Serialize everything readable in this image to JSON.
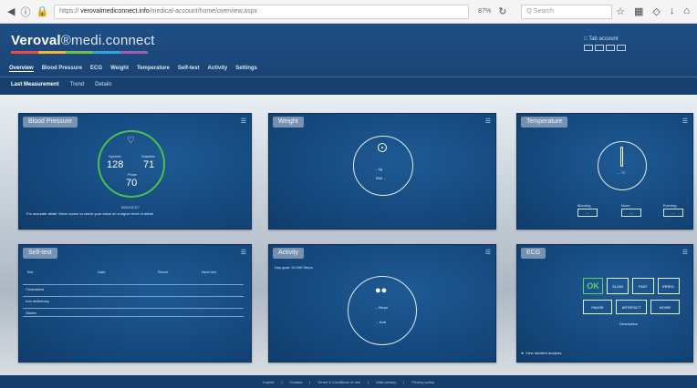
{
  "browser": {
    "url_prefix": "https://",
    "url_host": "verovalmediconnect.info",
    "url_path": "/medical-account/home/overview.aspx",
    "zoom": "87%",
    "search_placeholder": "Q Search"
  },
  "app": {
    "logo_bold": "Veroval",
    "logo_light": "®medi.connect",
    "user": "Tab account",
    "nav": [
      "Overview",
      "Blood Pressure",
      "ECG",
      "Weight",
      "Temperature",
      "Self-test",
      "Activity",
      "Settings"
    ],
    "active_nav": "Overview",
    "sub_nav": [
      "Last Measurement",
      "Trend",
      "Details"
    ],
    "active_sub_nav": "Last Measurement"
  },
  "cards": {
    "blood_pressure": {
      "title": "Blood Pressure",
      "systolic_label": "Systolic",
      "systolic": "128",
      "diastolic_label": "Diastolic",
      "diastolic": "71",
      "pulse_label": "Pulse",
      "pulse": "70",
      "date": "06/01/2017",
      "note": "For accurate detail: Move cursor to check your value on a higher level of detail."
    },
    "weight": {
      "title": "Weight",
      "value": "-- kg",
      "sub": "BMI --"
    },
    "temperature": {
      "title": "Temperature",
      "value": "-- °C",
      "boxes": [
        {
          "label": "Morning",
          "value": "--"
        },
        {
          "label": "Noon",
          "value": "--"
        },
        {
          "label": "Evening",
          "value": "--"
        }
      ]
    },
    "self_test": {
      "title": "Self-test",
      "headers": [
        "Test",
        "Date",
        "Result",
        "Next test"
      ],
      "rows": [
        "Cholesterol",
        "Iron deficiency",
        "Gluten"
      ]
    },
    "activity": {
      "title": "Activity",
      "header_text": "Day goal: 10,000 Steps",
      "steps": "-- Steps",
      "kcal": "-- kcal"
    },
    "ecg": {
      "title": "ECG",
      "ok_label": "OK",
      "tiles_top": [
        "SLOW",
        "FAST",
        "IRREG."
      ],
      "tiles_bottom": [
        "PAUSE",
        "ARTEFACT",
        "NOISE"
      ],
      "caption": "Description",
      "link": "View detailed analysis"
    }
  },
  "footer": [
    "Imprint",
    "Contact",
    "Terms & Conditions of use",
    "Data privacy",
    "Privacy policy"
  ],
  "colors": {
    "accent_green": "#49c34a",
    "brand_blue": "#1b4678"
  }
}
